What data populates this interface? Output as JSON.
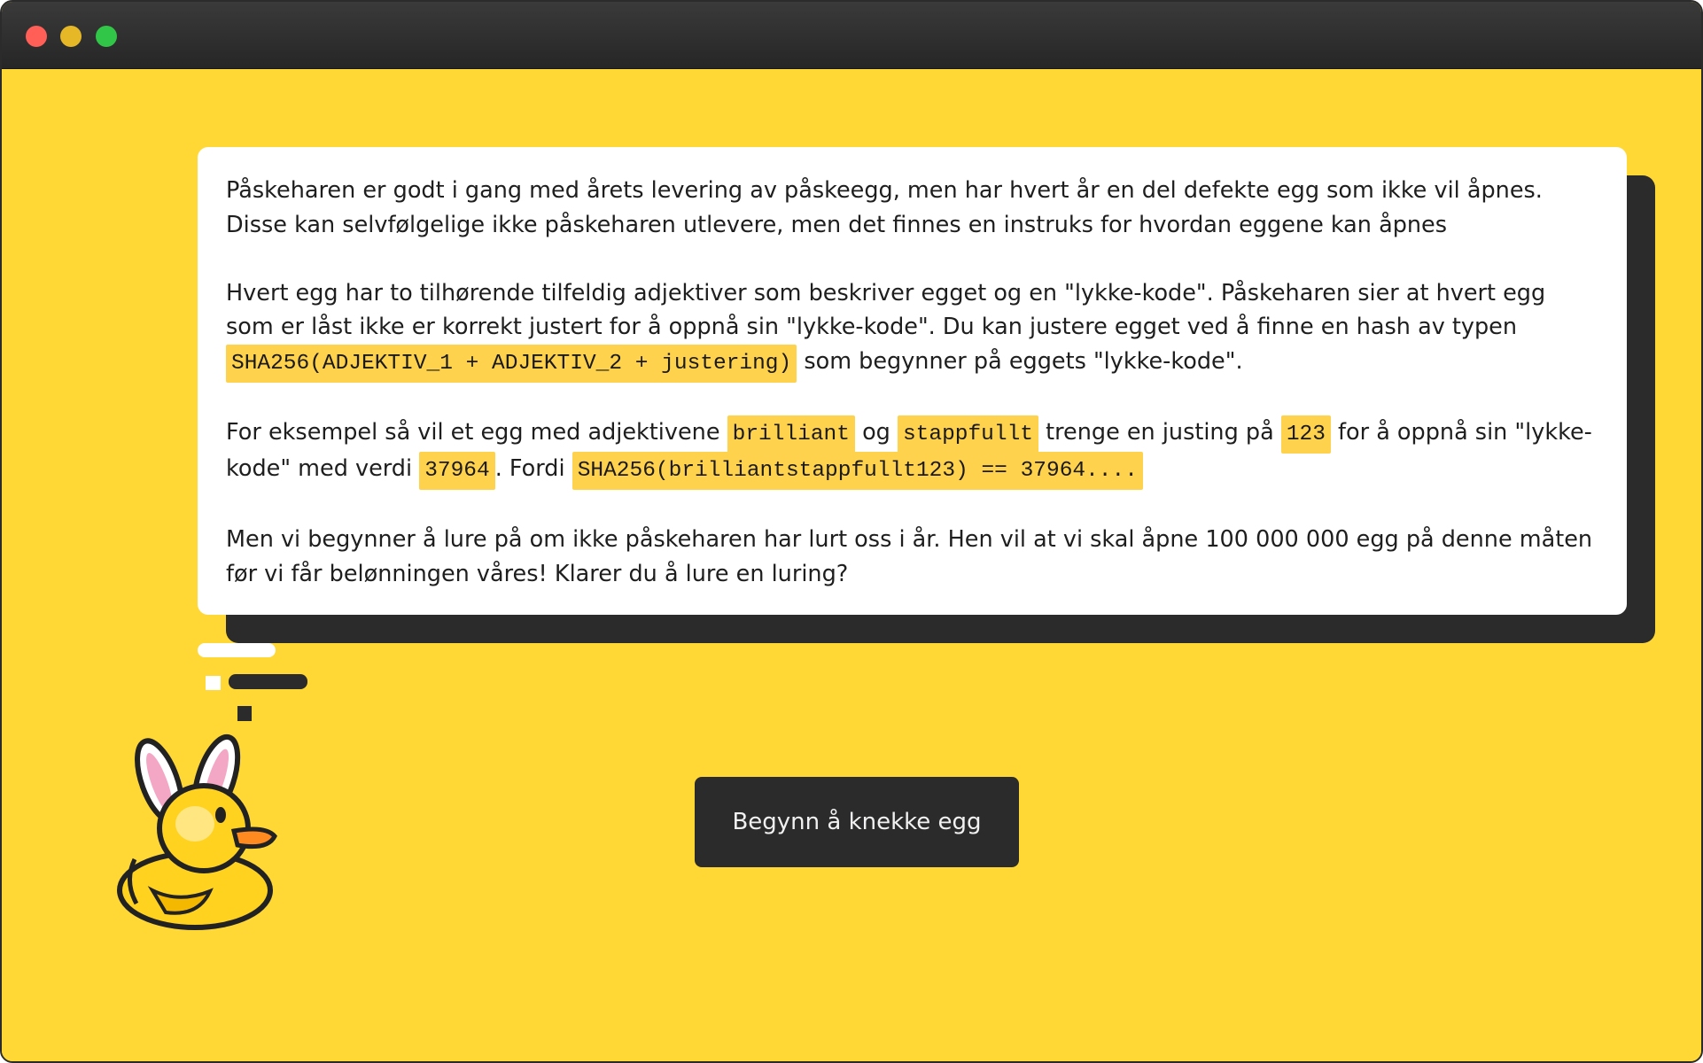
{
  "window": {
    "controls": [
      "close",
      "minimize",
      "maximize"
    ],
    "colors": {
      "background": "#ffd835",
      "dark": "#2b2b2c",
      "highlight": "#ffd24d"
    }
  },
  "intro": {
    "p1": "Påskeharen er godt i gang med årets levering av påskeegg, men har hvert år en del defekte egg som ikke vil åpnes. Disse kan selvfølgelige ikke påskeharen utlevere, men det finnes en instruks for hvordan eggene kan åpnes",
    "p2_text": "Hvert egg har to tilhørende tilfeldig adjektiver som beskriver egget og en \"lykke-kode\". Påskeharen sier at hvert egg som er låst ikke er korrekt justert for å oppnå sin \"lykke-kode\". Du kan justere egget ved å finne en hash av typen",
    "p2_code": "SHA256(ADJEKTIV_1 + ADJEKTIV_2 + justering)",
    "p2_tail": "som begynner på eggets \"lykke-kode\".",
    "p3_a": "For eksempel så vil et egg med adjektivene",
    "p3_code1": "brilliant",
    "p3_b": "og",
    "p3_code2": "stappfullt",
    "p3_c": "trenge en justing på",
    "p3_code3": "123",
    "p3_d": "for å oppnå sin \"lykke-kode\" med verdi",
    "p3_code4": "37964",
    "p3_e": ". Fordi",
    "p3_code5": "SHA256(brilliantstappfullt123) == 37964....",
    "p4": "Men vi begynner å lure på om ikke påskeharen har lurt oss i år. Hen vil at vi skal åpne 100 000 000 egg på denne måten før vi får belønningen våres! Klarer du å lure en luring?"
  },
  "mascot": {
    "icon": "bunny-duck-icon"
  },
  "start_button": {
    "label": "Begynn å knekke egg"
  }
}
